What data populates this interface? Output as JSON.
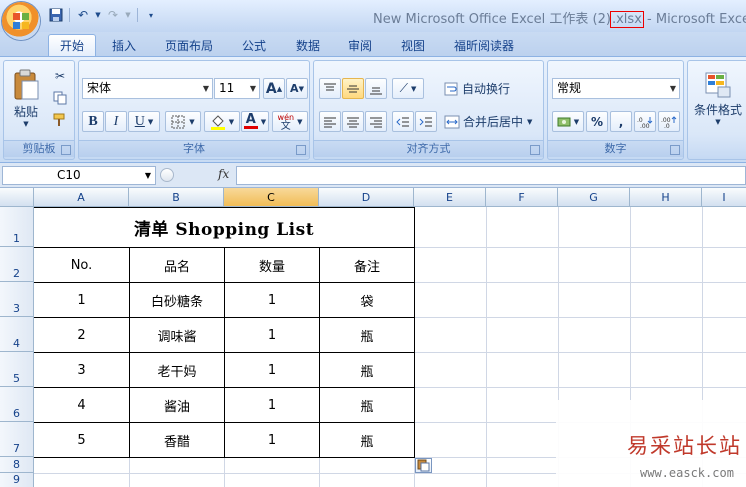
{
  "titlebar": {
    "doc_name": "New Microsoft Office Excel 工作表 (2)",
    "extension": ".xlsx",
    "app_suffix": " - Microsoft Excel"
  },
  "tabs": [
    "开始",
    "插入",
    "页面布局",
    "公式",
    "数据",
    "审阅",
    "视图",
    "福昕阅读器"
  ],
  "active_tab": "开始",
  "ribbon": {
    "clipboard": {
      "label": "剪贴板",
      "paste": "粘贴"
    },
    "font": {
      "label": "字体",
      "name": "宋体",
      "size": "11",
      "grow": "A",
      "shrink": "A",
      "bold": "B",
      "italic": "I",
      "underline": "U",
      "font_color_letter": "A",
      "phonetic": "wén"
    },
    "alignment": {
      "label": "对齐方式",
      "wrap_text": "自动换行",
      "merge_center": "合并后居中"
    },
    "number": {
      "label": "数字",
      "format": "常规",
      "percent": "%",
      "comma": ","
    },
    "styles": {
      "conditional_format": "条件格式"
    }
  },
  "formula_bar": {
    "name_box": "C10",
    "fx": "fx",
    "content": ""
  },
  "columns": [
    "A",
    "B",
    "C",
    "D",
    "E",
    "F",
    "G",
    "H",
    "I"
  ],
  "selected_column": "C",
  "rows": [
    "1",
    "2",
    "3",
    "4",
    "5",
    "6",
    "7",
    "8",
    "9"
  ],
  "sheet": {
    "title": "清单 Shopping List",
    "headers": [
      "No.",
      "品名",
      "数量",
      "备注"
    ],
    "items": [
      [
        "1",
        "白砂糖条",
        "1",
        "袋"
      ],
      [
        "2",
        "调味酱",
        "1",
        "瓶"
      ],
      [
        "3",
        "老干妈",
        "1",
        "瓶"
      ],
      [
        "4",
        "酱油",
        "1",
        "瓶"
      ],
      [
        "5",
        "香醋",
        "1",
        "瓶"
      ]
    ]
  },
  "watermark": {
    "line1": "易采站长站",
    "line2": "www.easck.com"
  },
  "colors": {
    "table_border": "#000000",
    "selected_col_header": "#f1bd57",
    "gridline": "#d0d7e5",
    "highlight_red": "#e00000"
  }
}
